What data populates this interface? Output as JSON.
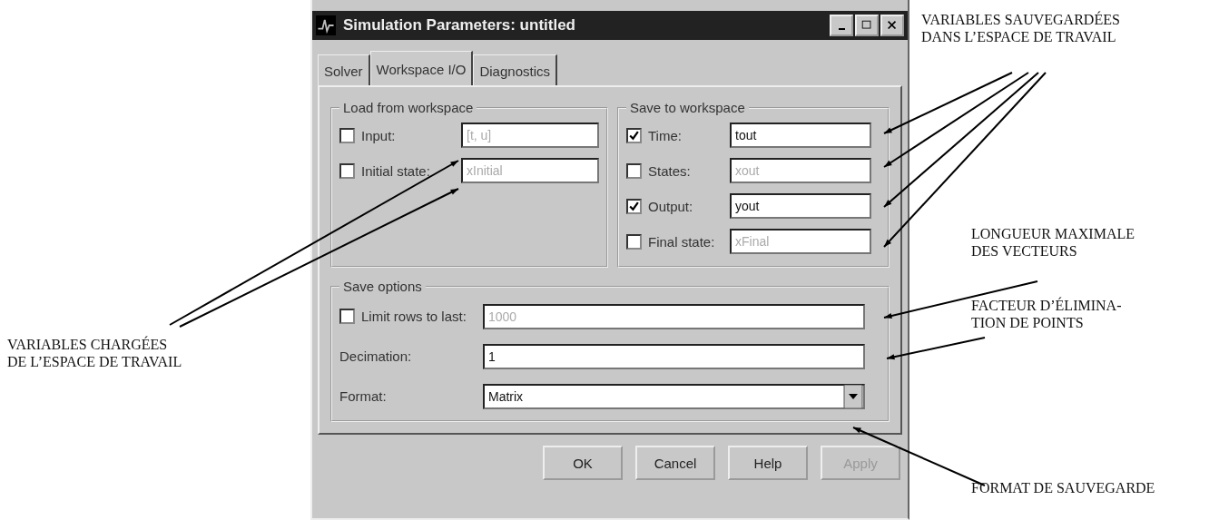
{
  "window": {
    "title": "Simulation Parameters: untitled"
  },
  "tabs": [
    {
      "label": "Solver",
      "selected": false
    },
    {
      "label": "Workspace I/O",
      "selected": true
    },
    {
      "label": "Diagnostics",
      "selected": false
    }
  ],
  "load_from_workspace": {
    "title": "Load from workspace",
    "rows": [
      {
        "label": "Input:",
        "checked": false,
        "value": "[t, u]"
      },
      {
        "label": "Initial state:",
        "checked": false,
        "value": "xInitial"
      }
    ]
  },
  "save_to_workspace": {
    "title": "Save to workspace",
    "rows": [
      {
        "label": "Time:",
        "checked": true,
        "value": "tout"
      },
      {
        "label": "States:",
        "checked": false,
        "value": "xout"
      },
      {
        "label": "Output:",
        "checked": true,
        "value": "yout"
      },
      {
        "label": "Final state:",
        "checked": false,
        "value": "xFinal"
      }
    ]
  },
  "save_options": {
    "title": "Save options",
    "limit_rows": {
      "label": "Limit rows to last:",
      "checked": false,
      "value": "1000"
    },
    "decimation": {
      "label": "Decimation:",
      "value": "1"
    },
    "format": {
      "label": "Format:",
      "value": "Matrix"
    }
  },
  "buttons": [
    {
      "label": "OK",
      "disabled": false
    },
    {
      "label": "Cancel",
      "disabled": false
    },
    {
      "label": "Help",
      "disabled": false
    },
    {
      "label": "Apply",
      "disabled": true
    }
  ],
  "annotations": [
    {
      "kind": "left",
      "text": "VARIABLES CHARGÉES\nDE L’ESPACE DE TRAVAIL"
    },
    {
      "kind": "saved",
      "text": "VARIABLES SAUVEGARDÉES\nDANS L’ESPACE DE TRAVAIL"
    },
    {
      "kind": "length",
      "text": "LONGUEUR MAXIMALE\nDES VECTEURS"
    },
    {
      "kind": "decimation",
      "text": "FACTEUR D’ÉLIMINA-\nTION DE POINTS"
    },
    {
      "kind": "format",
      "text": "FORMAT DE SAUVEGARDE"
    }
  ]
}
